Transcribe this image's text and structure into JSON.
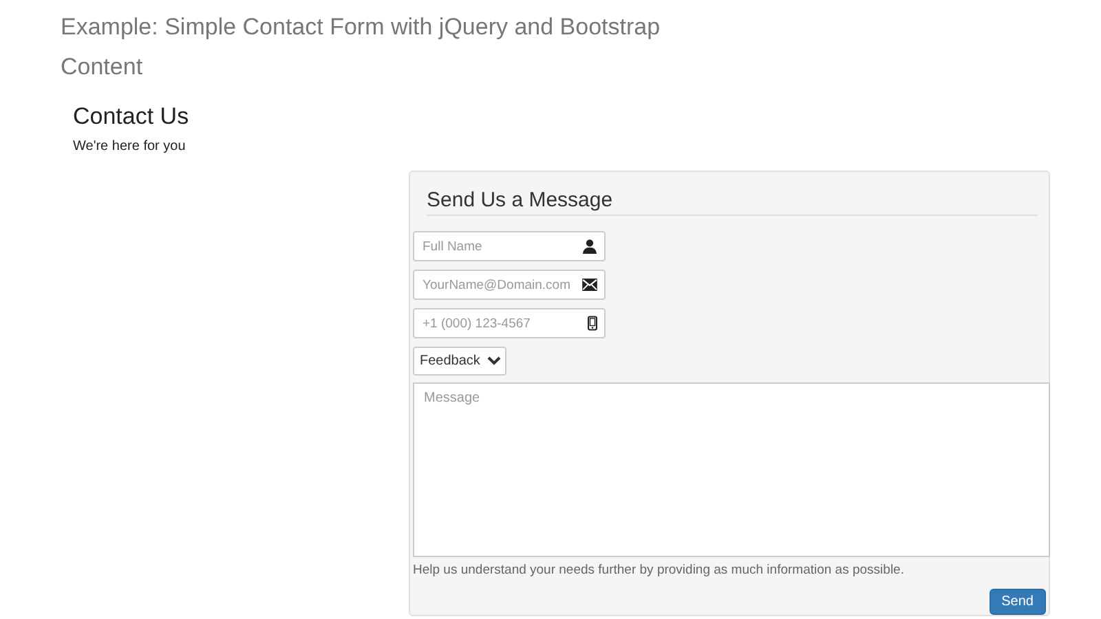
{
  "page_title": "Example: Simple Contact Form with jQuery and Bootstrap",
  "section_title": "Content",
  "contact": {
    "heading": "Contact Us",
    "subheading": "We're here for you"
  },
  "form": {
    "title": "Send Us a Message",
    "fields": [
      {
        "kind": "name",
        "placeholder": "Full Name"
      },
      {
        "kind": "email",
        "placeholder": "YourName@Domain.com"
      },
      {
        "kind": "phone",
        "placeholder": "+1 (000) 123-4567"
      },
      {
        "kind": "select",
        "value": "Feedback"
      },
      {
        "kind": "textarea",
        "placeholder": "Message"
      }
    ],
    "help": "Help us understand your needs further by providing as much information as possible.",
    "submit": "Send"
  }
}
